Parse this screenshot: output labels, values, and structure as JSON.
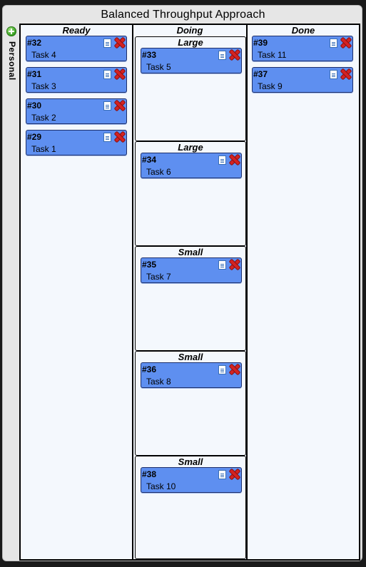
{
  "board": {
    "title": "Balanced Throughput Approach",
    "swimlane": "Personal",
    "add_icon": "plus-circle-icon"
  },
  "columns": [
    {
      "name": "Ready",
      "cards": [
        {
          "number": "#32",
          "title": "Task 4"
        },
        {
          "number": "#31",
          "title": "Task 3"
        },
        {
          "number": "#30",
          "title": "Task 2"
        },
        {
          "number": "#29",
          "title": "Task 1"
        }
      ]
    },
    {
      "name": "Doing",
      "cells": [
        {
          "label": "Large",
          "card": {
            "number": "#33",
            "title": "Task 5"
          }
        },
        {
          "label": "Large",
          "card": {
            "number": "#34",
            "title": "Task 6"
          }
        },
        {
          "label": "Small",
          "card": {
            "number": "#35",
            "title": "Task 7"
          }
        },
        {
          "label": "Small",
          "card": {
            "number": "#36",
            "title": "Task 8"
          }
        },
        {
          "label": "Small",
          "card": {
            "number": "#38",
            "title": "Task 10"
          }
        }
      ]
    },
    {
      "name": "Done",
      "cards": [
        {
          "number": "#39",
          "title": "Task 11"
        },
        {
          "number": "#37",
          "title": "Task 9"
        }
      ]
    }
  ],
  "card_icons": {
    "details": "document-icon",
    "delete": "delete-x-icon"
  },
  "colors": {
    "card": "#5e8ff0",
    "board_bg": "#f4f8fd",
    "frame_bg": "#e6e6e6"
  }
}
